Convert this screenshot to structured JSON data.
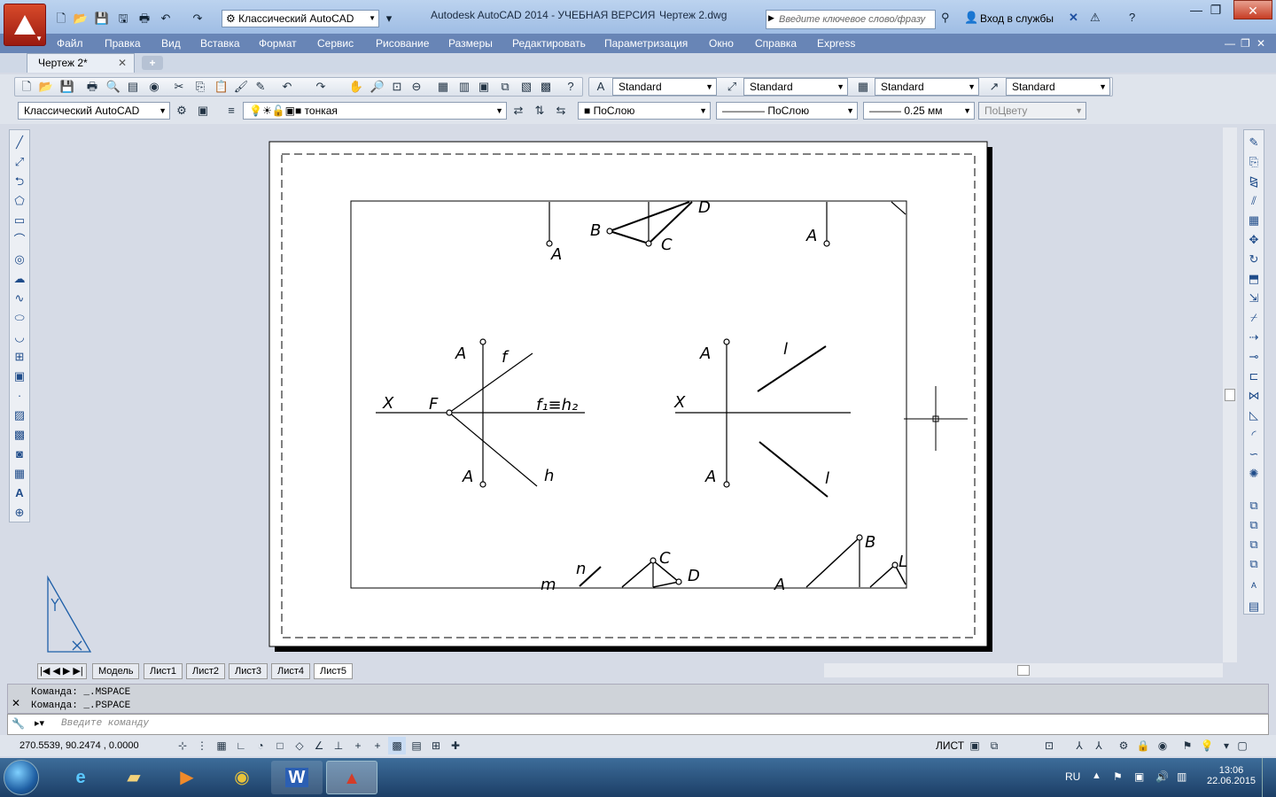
{
  "titlebar": {
    "app_title": "Autodesk AutoCAD 2014 - УЧЕБНАЯ ВЕРСИЯ",
    "doc_title": "Чертеж 2.dwg",
    "workspace": "Классический AutoCAD",
    "search_placeholder": "Введите ключевое слово/фразу",
    "signin": "Вход в службы"
  },
  "menubar": [
    "Файл",
    "Правка",
    "Вид",
    "Вставка",
    "Формат",
    "Сервис",
    "Рисование",
    "Размеры",
    "Редактировать",
    "Параметризация",
    "Окно",
    "Справка",
    "Express"
  ],
  "doc_tab": "Чертеж 2*",
  "styles": {
    "text_style": "Standard",
    "dim_style": "Standard",
    "table_style": "Standard",
    "mleader_style": "Standard"
  },
  "layers": {
    "workspace": "Классический AutoCAD",
    "layer": "тонкая",
    "color": "ПоСлою",
    "linetype": "ПоСлою",
    "lineweight": "0.25 мм",
    "plotstyle": "ПоЦвету"
  },
  "layout_tabs": [
    "Модель",
    "Лист1",
    "Лист2",
    "Лист3",
    "Лист4",
    "Лист5"
  ],
  "command": {
    "history": [
      "Команда:  _.MSPACE",
      "Команда:  _.PSPACE"
    ],
    "placeholder": "Введите команду"
  },
  "status": {
    "coords": "270.5539,  90.2474 , 0.0000",
    "space": "ЛИСТ"
  },
  "taskbar": {
    "lang": "RU",
    "time": "13:06",
    "date": "22.06.2015"
  },
  "drawing_labels": {
    "b1": "B",
    "d1": "D",
    "c1": "C",
    "a1_top": "A",
    "a1_topright": "A",
    "a2_left": "A",
    "f2": "f",
    "x12_left": "X",
    "f12": "F",
    "f1h2": "f₁≡h₂",
    "a1_left": "A",
    "h1": "h",
    "a2_right": "A",
    "l2": "l",
    "x12_right": "X",
    "a1_right": "A",
    "l1": "l",
    "m": "m",
    "n2": "n",
    "c2": "C",
    "d2": "D",
    "b2": "B",
    "a_bottom": "A",
    "l_bottom": "L"
  }
}
